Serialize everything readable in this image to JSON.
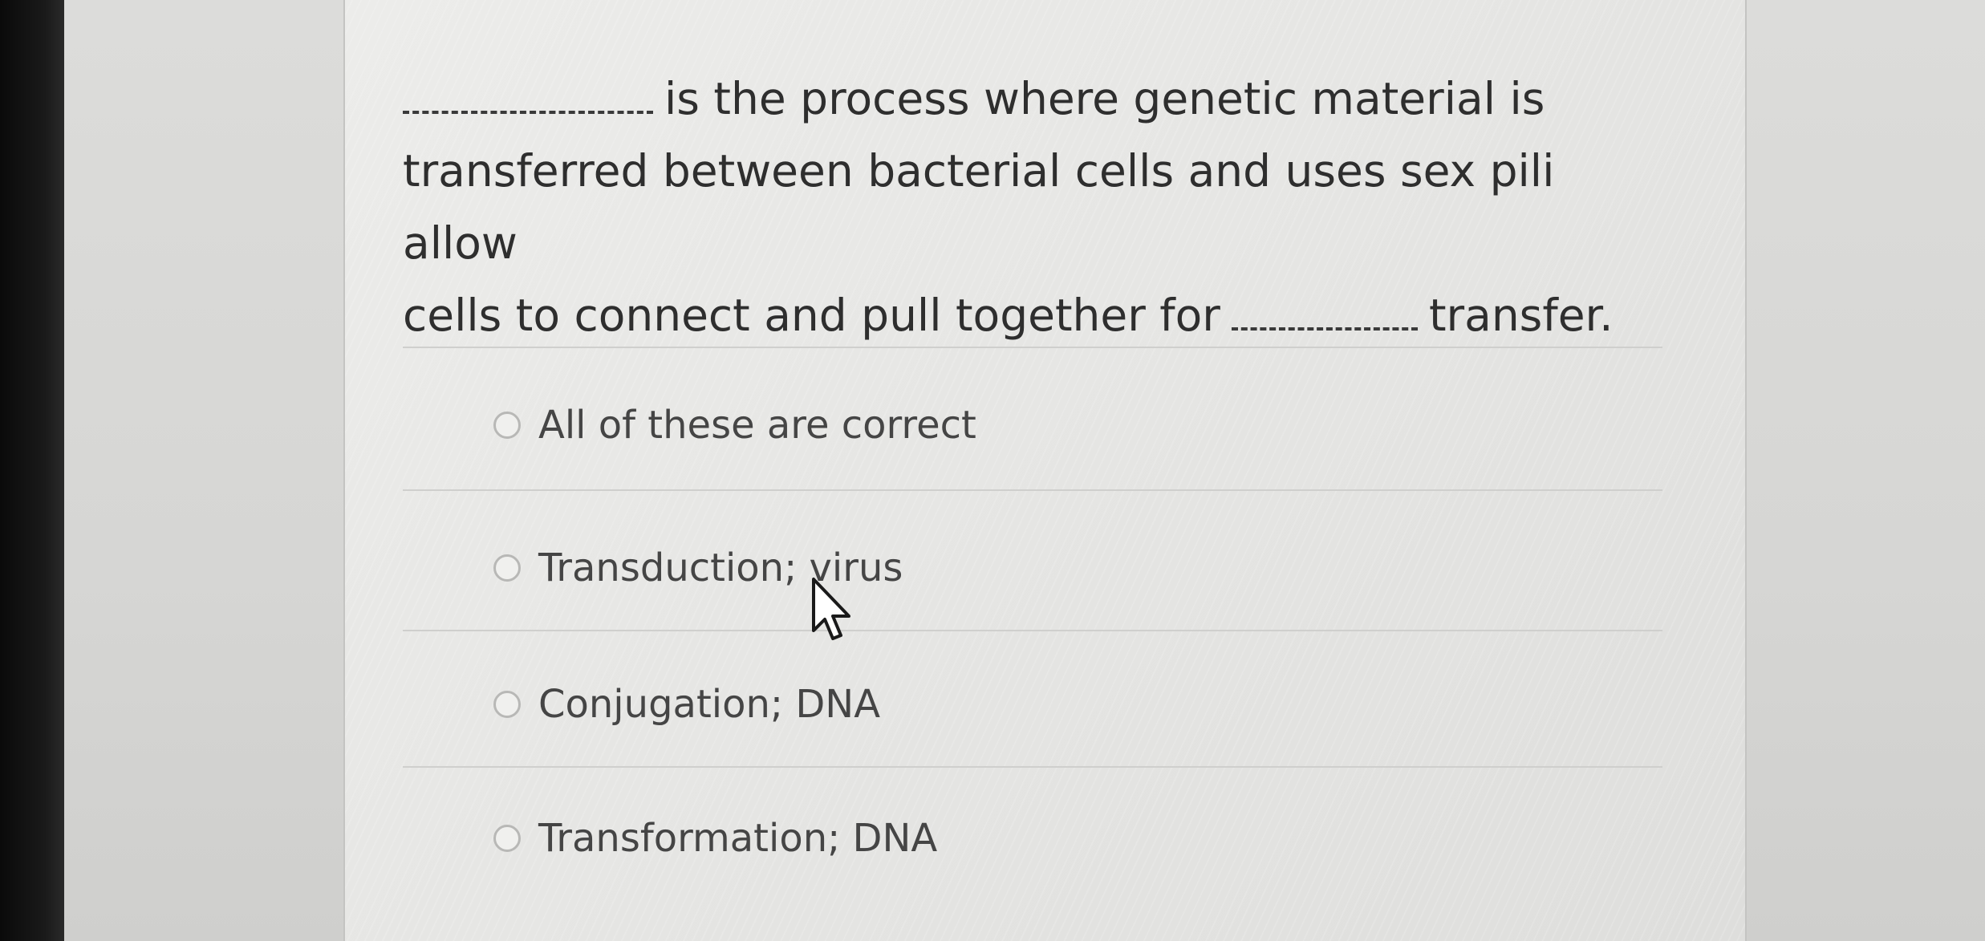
{
  "question": {
    "blank_1": "__________",
    "line_1_rest": "is the process where genetic material is",
    "line_2": "transferred between bacterial cells and uses sex pili allow",
    "line_3_start": "cells to connect and pull together for",
    "blank_2": "________",
    "line_3_end": "transfer."
  },
  "options": [
    {
      "label": "All of these are correct",
      "selected": false
    },
    {
      "label": "Transduction; virus",
      "selected": false
    },
    {
      "label": "Conjugation; DNA",
      "selected": false
    },
    {
      "label": "Transformation; DNA",
      "selected": false
    }
  ],
  "icons": {
    "radio": "radio-button-icon",
    "cursor": "mouse-pointer-icon"
  },
  "colors": {
    "text": "#2e2e2e",
    "option_text": "#454545",
    "panel": "#e6e6e4"
  }
}
